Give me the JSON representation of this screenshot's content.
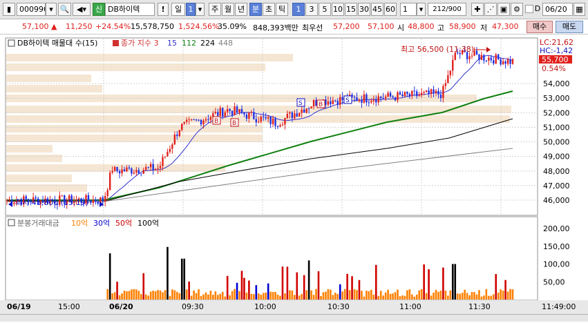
{
  "toolbar": {
    "code": "000990",
    "market_badge": "신",
    "stock_name": "DB하이텍",
    "period_label": "일",
    "period_num": "1",
    "periods": [
      "주",
      "월",
      "년",
      "분",
      "초",
      "틱"
    ],
    "minutes": [
      "1",
      "3",
      "5",
      "10",
      "15",
      "30",
      "45",
      "60"
    ],
    "interval_value": "1",
    "count_display": "212/900",
    "date_value": "06/20"
  },
  "quote": {
    "price": "57,100",
    "change": "11,250",
    "change_pct": "+24.54%",
    "volume": "15,578,750",
    "volume_pct": "1,524.56%",
    "turnover_pct": "35.09%",
    "amount": "848,393백만",
    "best_ask_label": "최우선",
    "best_ask": "57,200",
    "best_bid": "57,100",
    "open_label": "시",
    "open": "48,800",
    "high_label": "고",
    "high": "58,900",
    "low_label": "저",
    "low": "47,300",
    "buy_label": "매수",
    "sell_label": "매도"
  },
  "legend": {
    "stock": "DB하이텍 매물대 수(15)",
    "ma_title": "종가 지수 3",
    "ma": [
      "15",
      "112",
      "224",
      "448"
    ],
    "ma_colors": [
      "#3030d0",
      "#108010",
      "#000000",
      "#808080"
    ]
  },
  "price_axis": [
    "54,000",
    "53,000",
    "52,000",
    "51,000",
    "50,000",
    "49,000",
    "48,000",
    "47,000",
    "46,000"
  ],
  "right_info": {
    "lc": "LC:21,62",
    "hc": "HC:-1,42",
    "current": "55,700",
    "pct": "0.54%"
  },
  "annotations": {
    "high": "최고 56,500 (11:38)",
    "low": "최저 45,800 (15:19)"
  },
  "volume_legend": {
    "title": "분봉거래대금",
    "items": [
      "10억",
      "30억",
      "50억",
      "100억"
    ],
    "colors": [
      "#ff8000",
      "#0000d0",
      "#d00000",
      "#000000"
    ]
  },
  "volume_axis": [
    "200,00",
    "150,00",
    "100,00",
    "50,00"
  ],
  "time_axis": [
    "06/19",
    "15:00",
    "06/20",
    "09:30",
    "10:00",
    "10:30",
    "11:00",
    "11:30"
  ],
  "time_right": "11:49:00",
  "colors": {
    "up": "#e0201c",
    "down": "#2030e0",
    "volume_profile": "#f5e6d3"
  }
}
